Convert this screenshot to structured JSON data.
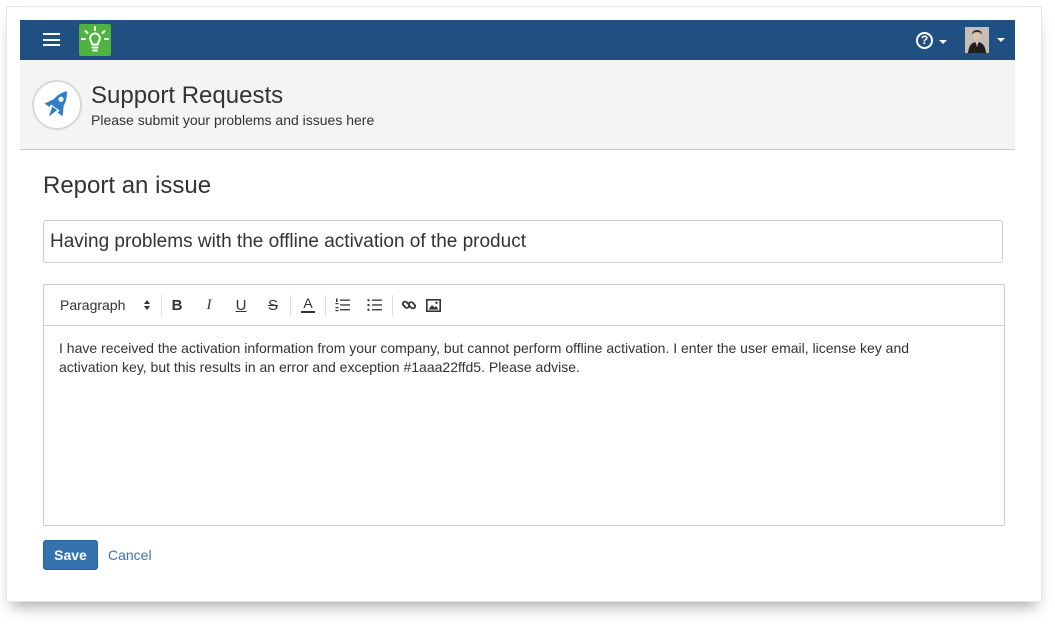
{
  "header": {
    "project_title": "Support Requests",
    "project_subtitle": "Please submit your problems and issues here"
  },
  "topbar": {
    "menu_icon": "hamburger-icon",
    "logo_icon": "lightbulb-icon",
    "help_icon": "help-icon",
    "help_glyph": "?",
    "avatar_icon": "user-avatar-icon"
  },
  "form": {
    "page_title": "Report an issue",
    "summary_value": "Having problems with the offline activation of the product",
    "toolbar": {
      "format_label": "Paragraph",
      "bold": "B",
      "italic": "I",
      "underline": "U",
      "strikethrough": "S",
      "text_color": "A"
    },
    "description": "I have received the activation information from your company, but cannot perform offline activation. I enter the user email, license key and activation key, but this results in an error and exception #1aaa22ffd5. Please advise.",
    "save_label": "Save",
    "cancel_label": "Cancel"
  },
  "colors": {
    "topbar": "#205081",
    "logo": "#4fb342",
    "primary_button": "#3572b0",
    "link": "#3b73af"
  }
}
